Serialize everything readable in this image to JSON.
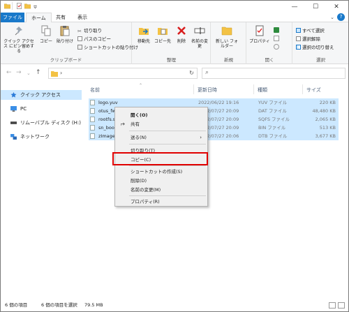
{
  "window": {
    "controls": {
      "minimize": "—",
      "maximize": "☐",
      "close": "✕"
    },
    "title_icons": [
      "folder-icon",
      "properties-icon",
      "new-folder-icon",
      "dropdown-icon"
    ]
  },
  "tabs": [
    {
      "label": "ファイル"
    },
    {
      "label": "ホーム"
    },
    {
      "label": "共有"
    },
    {
      "label": "表示"
    }
  ],
  "ribbon": {
    "clipboard": {
      "label": "クリップボード",
      "pin_quick_access": "クイック アクセス にピン留めする",
      "copy": "コピー",
      "paste": "貼り付け",
      "cut": "切り取り",
      "copy_path": "パスのコピー",
      "paste_shortcut": "ショートカットの貼り付け"
    },
    "organize": {
      "label": "整理",
      "move_to": "移動先",
      "copy_to": "コピー先",
      "delete": "削除",
      "rename": "名前の変更"
    },
    "new": {
      "label": "新規",
      "new_folder": "新しい フォルダー"
    },
    "open": {
      "label": "開く",
      "properties": "プロパティ"
    },
    "select": {
      "label": "選択",
      "select_all": "すべて選択",
      "select_none": "選択解除",
      "invert_selection": "選択の切り替え"
    }
  },
  "address": {
    "path_separator": "›"
  },
  "nav_pane": {
    "items": [
      {
        "label": "クイック アクセス"
      },
      {
        "label": "PC"
      },
      {
        "label": "リムーバブル ディスク (H:)"
      },
      {
        "label": "ネットワーク"
      }
    ]
  },
  "file_list": {
    "columns": {
      "name": "名前",
      "modified": "更新日時",
      "type": "種類",
      "size": "サイズ"
    },
    "rows": [
      {
        "name": "logo.yuv",
        "modified": "2022/06/22 19:16",
        "type": "YUV ファイル",
        "size": "220 KB"
      },
      {
        "name": "otus_fw",
        "modified": "2022/07/27 20:09",
        "type": "DAT ファイル",
        "size": "48,480 KB"
      },
      {
        "name": "rootfs.s",
        "modified": "2022/07/27 20:09",
        "type": "SQFS ファイル",
        "size": "2,065 KB"
      },
      {
        "name": "sn_boot",
        "modified": "2022/07/27 20:09",
        "type": "BIN ファイル",
        "size": "513 KB"
      },
      {
        "name": "zImage.",
        "modified": "2022/07/27 20:06",
        "type": "DTB ファイル",
        "size": "3,677 KB"
      }
    ]
  },
  "context_menu": {
    "open": "開く(O)",
    "share": "共有",
    "send_to": "送る(N)",
    "cut": "切り取り(T)",
    "copy": "コピー(C)",
    "create_shortcut": "ショートカットの作成(S)",
    "delete": "削除(D)",
    "rename": "名前の変更(M)",
    "properties": "プロパティ(R)"
  },
  "status_bar": {
    "item_count": "6 個の項目",
    "selected": "6 個の項目を選択",
    "size": "79.5 MB"
  },
  "colors": {
    "accent": "#1979ca",
    "selection": "#cce8ff",
    "highlight_box": "#e00000"
  }
}
